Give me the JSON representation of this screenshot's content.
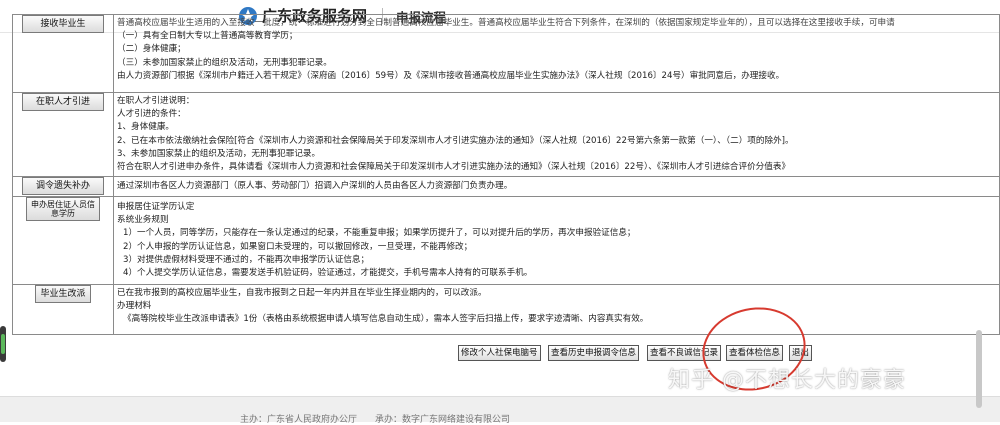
{
  "header": {
    "site_title": "广东政务服务网",
    "page_title": "申报流程"
  },
  "rows": [
    {
      "label": "接收毕业生",
      "lines": [
        "普通高校应届毕业生适用的入至接收一批度，统一标准进行划分到全日制普通高校应届毕业生。普通高校应届毕业生符合下列条件，在深圳的（依据国家规定毕业年的），且可以选择在这里接收手续，可申请",
        "（一）具有全日制大专以上普通高等教育学历；",
        "（二）身体健康；",
        "（三）未参加国家禁止的组织及活动，无刑事犯罪记录。",
        "由人力资源部门根据《深圳市户籍迁入若干规定》（深府函〔2016〕59号）及《深圳市接收普通高校应届毕业生实施办法》（深人社规〔2016〕24号）审批同意后，办理接收。"
      ]
    },
    {
      "label": "在职人才引进",
      "lines": [
        "在职人才引进说明：",
        "人才引进的条件：",
        "1、身体健康。",
        "2、已在本市依法缴纳社会保险[符合《深圳市人力资源和社会保障局关于印发深圳市人才引进实施办法的通知》（深人社规〔2016〕22号第六条第一款第（一）、（二）项的除外]。",
        "3、未参加国家禁止的组织及活动，无刑事犯罪记录。",
        "符合在职人才引进申办条件，具体请看《深圳市人力资源和社会保障局关于印发深圳市人才引进实施办法的通知》（深人社规〔2016〕22号）、《深圳市人才引进综合评价分值表》"
      ]
    },
    {
      "label": "调令遗失补办",
      "lines": [
        "通过深圳市各区人力资源部门（原人事、劳动部门）招调入户深圳的人员由各区人力资源部门负责办理。"
      ]
    },
    {
      "label": "申办居住证人员信息学历",
      "lines": [
        "申报居住证学历认定",
        "系统业务规则",
        "1）一个人员，同等学历，只能存在一条认定通过的纪录，不能重复申报；如果学历提升了，可以对提升后的学历，再次申报验证信息；",
        "2）个人申报的学历认证信息，如果窗口未受理的，可以撤回修改，一旦受理，不能再修改；",
        "3）对提供虚假材料受理不通过的，不能再次申报学历认证信息；",
        "4）个人提交学历认证信息，需要发送手机验证码，验证通过，才能提交，手机号需本人持有的可联系手机。"
      ]
    },
    {
      "label": "毕业生改派",
      "lines": [
        "已在我市报到的高校应届毕业生，自我市报到之日起一年内并且在毕业生择业期内的，可以改派。",
        "办理材料",
        "《高等院校毕业生改派申请表》1份（表格由系统根据申请人填写信息自动生成），需本人签字后扫描上传，要求字迹清晰、内容真实有效。"
      ]
    }
  ],
  "actions": [
    {
      "label": "修改个人社保电脑号"
    },
    {
      "label": "查看历史申报调令信息"
    },
    {
      "label": "查看不良诚信记录"
    },
    {
      "label": "查看体检信息"
    },
    {
      "label": "退出"
    }
  ],
  "watermark": "知乎 @不想长大的豪豪",
  "footer": {
    "text": "主办：广东省人民政府办公厅　　承办：数字广东网络建设有限公司"
  },
  "colors": {
    "annotation": "#d73a2f",
    "border": "#8a8a8a"
  }
}
